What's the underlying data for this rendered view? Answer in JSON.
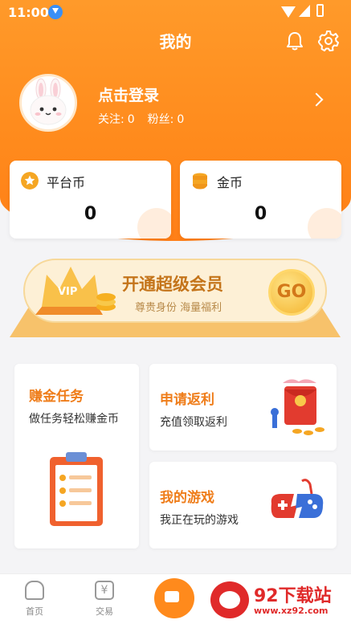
{
  "status_bar": {
    "time": "11:00"
  },
  "header": {
    "title": "我的"
  },
  "profile": {
    "login_prompt": "点击登录",
    "following_label": "关注:",
    "following_count": "0",
    "fans_label": "粉丝:",
    "fans_count": "0"
  },
  "wallet": {
    "platform_coin": {
      "label": "平台币",
      "value": "0"
    },
    "gold_coin": {
      "label": "金币",
      "value": "0"
    }
  },
  "vip_banner": {
    "badge": "VIP",
    "title": "开通超级会员",
    "subtitle": "尊贵身份 海量福利",
    "go_label": "GO"
  },
  "cards": {
    "earn_task": {
      "title": "赚金任务",
      "subtitle": "做任务轻松赚金币"
    },
    "rebate": {
      "title": "申请返利",
      "subtitle": "充值领取返利"
    },
    "my_games": {
      "title": "我的游戏",
      "subtitle": "我正在玩的游戏"
    }
  },
  "bottom_nav": {
    "home": "首页",
    "trade": "交易",
    "trade_icon_glyph": "¥"
  },
  "watermark": {
    "brand": "92下载站",
    "url": "www.xz92.com"
  },
  "colors": {
    "accent": "#ff8a1c",
    "accent_text": "#ef7d1a",
    "coin_gold": "#f5a623"
  }
}
